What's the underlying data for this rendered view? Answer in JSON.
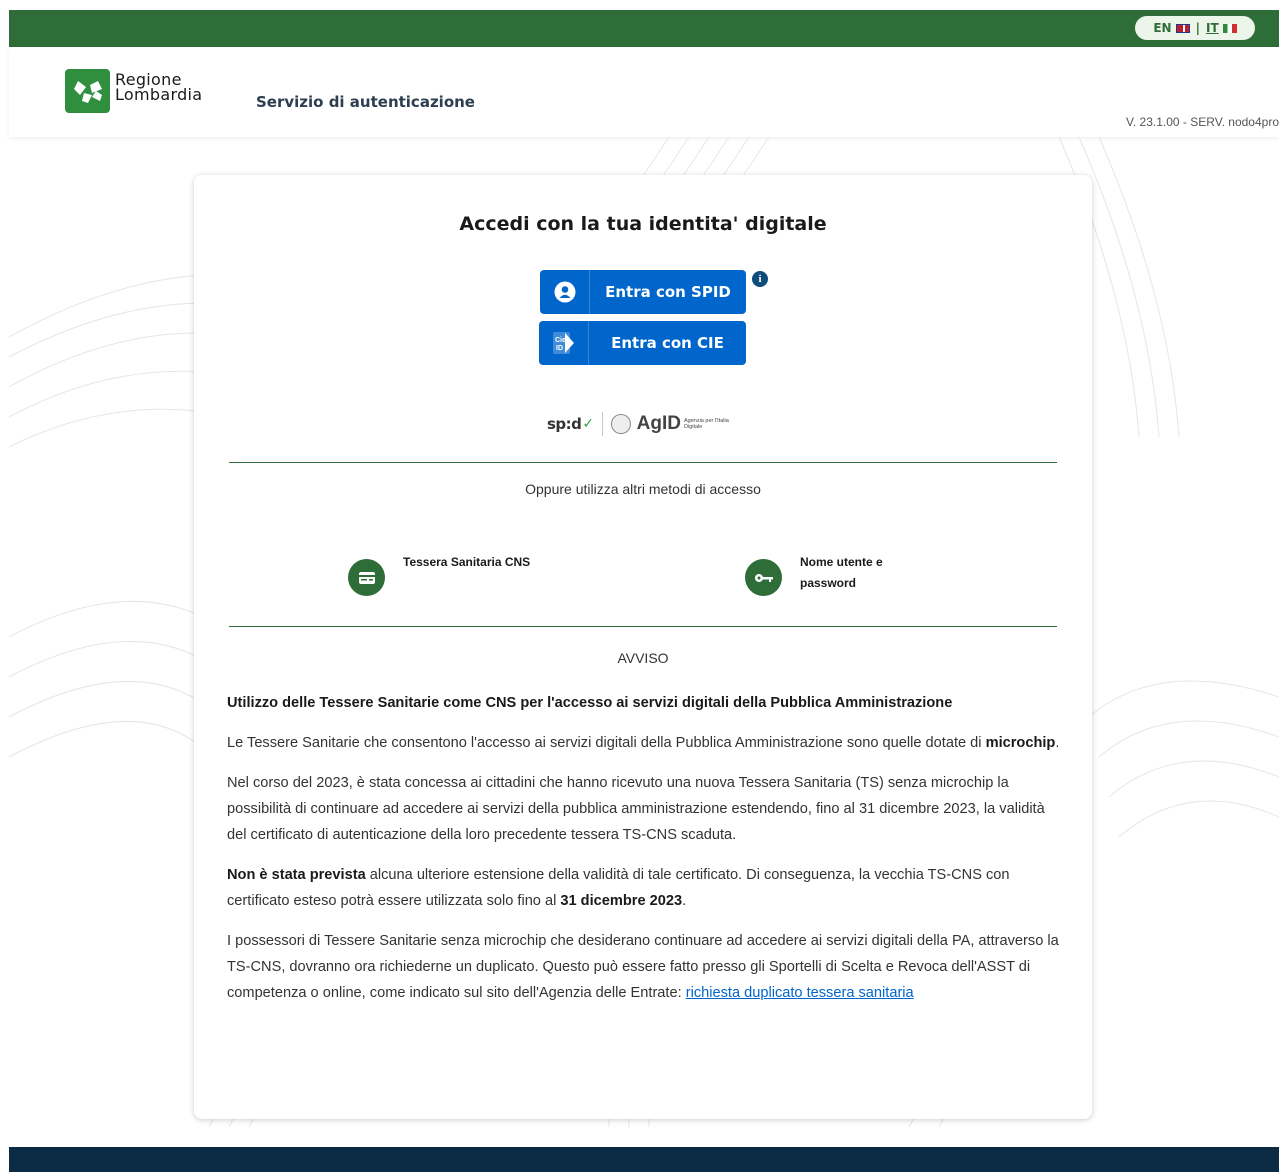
{
  "topbar": {
    "lang_en": "EN",
    "lang_separator": "|",
    "lang_it": "IT"
  },
  "header": {
    "logo_line1": "Regione",
    "logo_line2": "Lombardia",
    "service_title": "Servizio di autenticazione",
    "version": "V. 23.1.00 - SERV. nodo4pro"
  },
  "card": {
    "title": "Accedi con la tua identita' digitale",
    "spid_button": "Entra con SPID",
    "cie_button": "Entra con CIE",
    "cie_icon_text": "Cie ID",
    "info_badge": "i",
    "spid_logo": "sp:d",
    "agid_logo": "AgID",
    "agid_subtitle": "Agenzia per l'Italia Digitale",
    "alt_label": "Oppure utilizza altri metodi di accesso",
    "alt_methods": [
      {
        "label": "Tessera Sanitaria CNS",
        "icon": "card-icon"
      },
      {
        "label": "Nome utente e password",
        "icon": "key-icon"
      }
    ]
  },
  "notice": {
    "heading": "AVVISO",
    "headline": "Utilizzo delle Tessere Sanitarie come CNS per l'accesso ai servizi digitali della Pubblica Amministrazione",
    "p1_text": "Le Tessere Sanitarie che consentono l'accesso ai servizi digitali della Pubblica Amministrazione sono quelle dotate di ",
    "p1_bold": "microchip",
    "p1_end": ".",
    "p2": "Nel corso del 2023, è stata concessa ai cittadini che hanno ricevuto una nuova Tessera Sanitaria (TS) senza microchip la possibilità di continuare ad accedere ai servizi della pubblica amministrazione estendendo, fino al 31 dicembre 2023, la validità del certificato di autenticazione della loro precedente tessera TS-CNS scaduta.",
    "p3_bold": "Non è stata prevista",
    "p3_text": " alcuna ulteriore estensione della validità di tale certificato. Di conseguenza, la vecchia TS-CNS con certificato esteso potrà essere utilizzata solo fino al ",
    "p3_bold2": "31 dicembre 2023",
    "p3_end": ".",
    "p4_text": "I possessori di Tessere Sanitarie senza microchip che desiderano continuare ad accedere ai servizi digitali della PA, attraverso la TS-CNS, dovranno ora richiederne un duplicato. Questo può essere fatto presso gli Sportelli di Scelta e Revoca dell'ASST di competenza o online, come indicato sul sito dell'Agenzia delle Entrate: ",
    "p4_link": "richiesta duplicato tessera sanitaria"
  },
  "colors": {
    "brand_green": "#2e6c38",
    "button_blue": "#0066cc",
    "footer_navy": "#0b2a44"
  }
}
